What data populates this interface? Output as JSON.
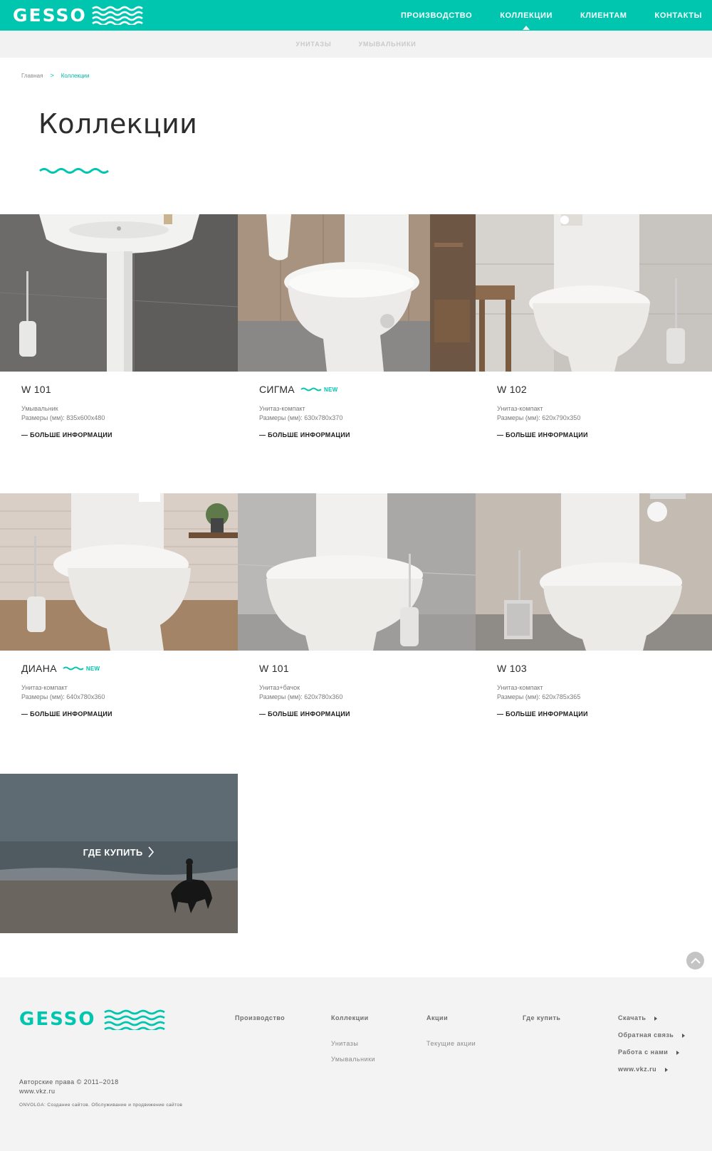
{
  "brand": {
    "logo_text": "GESSO",
    "accent_color": "#00c6b0"
  },
  "header": {
    "nav": [
      {
        "label": "ПРОИЗВОДСТВО",
        "active": false
      },
      {
        "label": "КОЛЛЕКЦИИ",
        "active": true
      },
      {
        "label": "КЛИЕНТАМ",
        "active": false
      },
      {
        "label": "КОНТАКТЫ",
        "active": false
      }
    ]
  },
  "subnav": {
    "items": [
      "УНИТАЗЫ",
      "УМЫВАЛЬНИКИ"
    ]
  },
  "breadcrumb": {
    "home": "Главная",
    "separator": ">",
    "current": "Коллекции"
  },
  "page": {
    "title": "Коллекции"
  },
  "products": [
    {
      "name": "W 101",
      "badge": "",
      "type": "Умывальник",
      "size": "Размеры (мм): 835x600x480",
      "more": "— БОЛЬШЕ ИНФОРМАЦИИ"
    },
    {
      "name": "СИГМА",
      "badge": "NEW",
      "type": "Унитаз-компакт",
      "size": "Размеры (мм): 630x780x370",
      "more": "— БОЛЬШЕ ИНФОРМАЦИИ"
    },
    {
      "name": "W 102",
      "badge": "",
      "type": "Унитаз-компакт",
      "size": "Размеры (мм): 620x790x350",
      "more": "— БОЛЬШЕ ИНФОРМАЦИИ"
    },
    {
      "name": "ДИАНА",
      "badge": "NEW",
      "type": "Унитаз-компакт",
      "size": "Размеры (мм): 640x780x360",
      "more": "— БОЛЬШЕ ИНФОРМАЦИИ"
    },
    {
      "name": "W 101",
      "badge": "",
      "type": "Унитаз+бачок",
      "size": "Размеры (мм): 620x780x360",
      "more": "— БОЛЬШЕ ИНФОРМАЦИИ"
    },
    {
      "name": "W 103",
      "badge": "",
      "type": "Унитаз-компакт",
      "size": "Размеры (мм): 620x785x365",
      "more": "— БОЛЬШЕ ИНФОРМАЦИИ"
    }
  ],
  "where_to_buy": {
    "label": "ГДЕ КУПИТЬ"
  },
  "footer": {
    "logo_text": "GESSO",
    "columns": [
      {
        "title": "Производство",
        "links": []
      },
      {
        "title": "Коллекции",
        "links": [
          "Унитазы",
          "Умывальники"
        ]
      },
      {
        "title": "Акции",
        "links": [
          "Текущие акции"
        ]
      },
      {
        "title": "Где купить",
        "links": []
      }
    ],
    "side_links": [
      "Скачать",
      "Обратная связь",
      "Работа с нами",
      "www.vkz.ru"
    ],
    "copyright": "Авторские права © 2011–2018",
    "site": "www.vkz.ru",
    "credit": "ONVOLGA: Создание сайтов. Обслуживание и продвижение сайтов"
  }
}
